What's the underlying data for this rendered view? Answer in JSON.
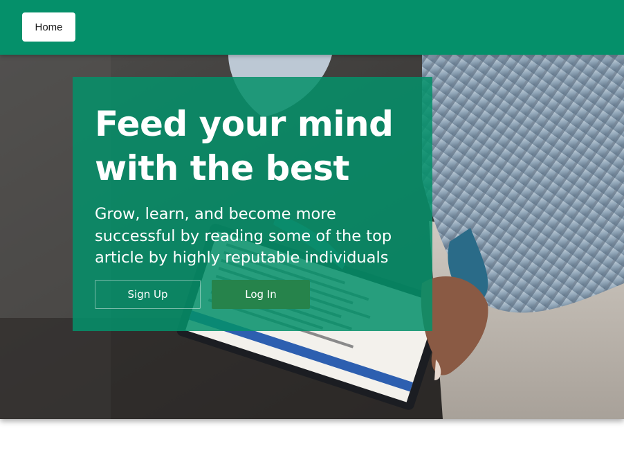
{
  "navbar": {
    "home_label": "Home",
    "background_color": "#05906a"
  },
  "hero": {
    "title": "Feed your mind with the best",
    "subtitle": "Grow, learn, and become more successful by reading some of the top article by highly reputable individuals",
    "signup_label": "Sign Up",
    "login_label": "Log In",
    "card_color": "#05906a",
    "login_button_color": "#26834b",
    "image": "person-writing-on-tablet-photo"
  }
}
